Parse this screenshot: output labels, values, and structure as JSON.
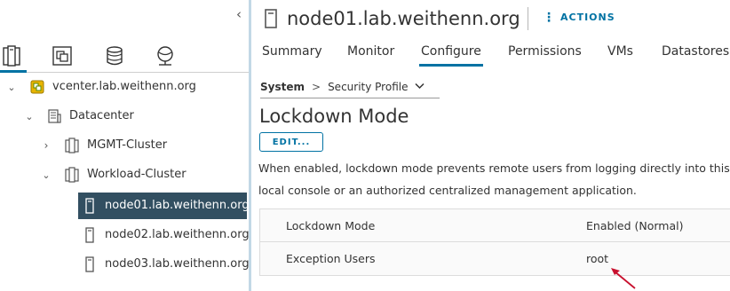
{
  "nav": {
    "collapse_glyph": "‹",
    "icon_tabs": [
      "hosts-and-clusters-icon",
      "vms-and-templates-icon",
      "storage-icon",
      "networking-icon"
    ],
    "tree": [
      {
        "label": "vcenter.lab.weithenn.org",
        "icon": "vcenter-icon",
        "expanded": true
      },
      {
        "label": "Datacenter",
        "icon": "datacenter-icon",
        "expanded": true
      },
      {
        "label": "MGMT-Cluster",
        "icon": "cluster-icon",
        "expanded": false
      },
      {
        "label": "Workload-Cluster",
        "icon": "cluster-icon",
        "expanded": true
      },
      {
        "label": "node01.lab.weithenn.org",
        "icon": "host-icon",
        "selected": true
      },
      {
        "label": "node02.lab.weithenn.org",
        "icon": "host-icon"
      },
      {
        "label": "node03.lab.weithenn.org",
        "icon": "host-icon"
      }
    ]
  },
  "header": {
    "title": "node01.lab.weithenn.org",
    "actions_label": "ACTIONS"
  },
  "tabs": [
    "Summary",
    "Monitor",
    "Configure",
    "Permissions",
    "VMs",
    "Datastores"
  ],
  "active_tab": "Configure",
  "breadcrumb": {
    "section": "System",
    "separator": ">",
    "current": "Security Profile"
  },
  "lockdown": {
    "title": "Lockdown Mode",
    "edit_label": "EDIT...",
    "description_line1": "When enabled, lockdown mode prevents remote users from logging directly into this",
    "description_line2": "local console or an authorized centralized management application.",
    "rows": [
      {
        "key": "Lockdown Mode",
        "value": "Enabled (Normal)"
      },
      {
        "key": "Exception Users",
        "value": "root"
      }
    ]
  },
  "colors": {
    "accent": "#0072a3",
    "selected_row": "#324f61",
    "annotation_arrow": "#c8102e"
  }
}
